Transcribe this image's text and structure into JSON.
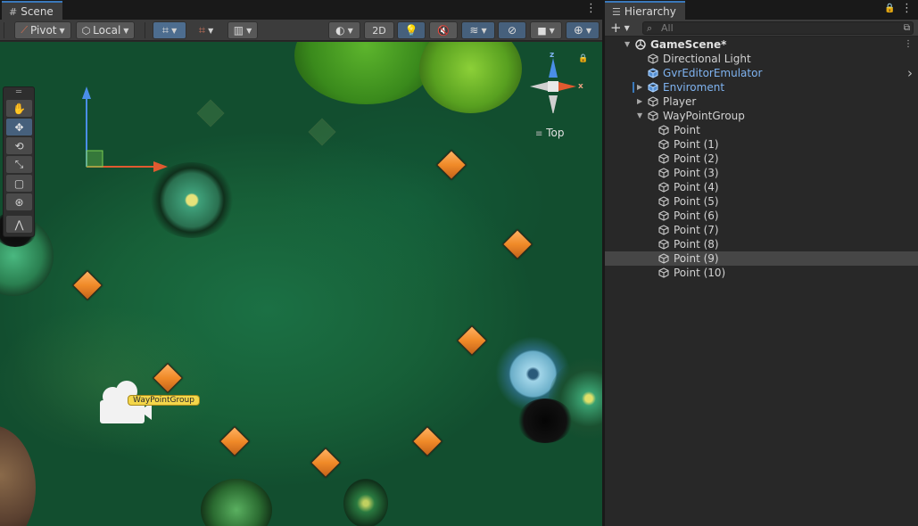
{
  "scene": {
    "tab_label": "Scene",
    "toolbar": {
      "pivot_label": "Pivot",
      "local_label": "Local",
      "mode_2d_label": "2D"
    },
    "gizmo": {
      "view_label": "Top",
      "axis_z": "z",
      "axis_x": "x"
    },
    "waypoint_label": "WayPointGroup",
    "tool_icons": [
      "hand-icon",
      "move-icon",
      "rotate-icon",
      "scale-icon",
      "rect-icon",
      "transform-icon",
      "custom-tool-icon"
    ]
  },
  "hierarchy": {
    "tab_label": "Hierarchy",
    "search_placeholder": "All",
    "items": [
      {
        "label": "GameScene*",
        "depth": 0,
        "type": "scene"
      },
      {
        "label": "Directional Light",
        "depth": 1,
        "type": "object"
      },
      {
        "label": "GvrEditorEmulator",
        "depth": 1,
        "type": "prefab"
      },
      {
        "label": "Enviroment",
        "depth": 1,
        "type": "prefab-collapsed"
      },
      {
        "label": "Player",
        "depth": 1,
        "type": "collapsed"
      },
      {
        "label": "WayPointGroup",
        "depth": 1,
        "type": "expanded"
      },
      {
        "label": "Point",
        "depth": 2,
        "type": "object"
      },
      {
        "label": "Point (1)",
        "depth": 2,
        "type": "object"
      },
      {
        "label": "Point (2)",
        "depth": 2,
        "type": "object"
      },
      {
        "label": "Point (3)",
        "depth": 2,
        "type": "object"
      },
      {
        "label": "Point (4)",
        "depth": 2,
        "type": "object"
      },
      {
        "label": "Point (5)",
        "depth": 2,
        "type": "object"
      },
      {
        "label": "Point (6)",
        "depth": 2,
        "type": "object"
      },
      {
        "label": "Point (7)",
        "depth": 2,
        "type": "object"
      },
      {
        "label": "Point (8)",
        "depth": 2,
        "type": "object"
      },
      {
        "label": "Point (9)",
        "depth": 2,
        "type": "object",
        "highlighted": true
      },
      {
        "label": "Point (10)",
        "depth": 2,
        "type": "object"
      }
    ]
  },
  "colors": {
    "accent": "#3a79bb",
    "prefab_blue": "#7fb3f0",
    "waypoint_orange": "#f08a28"
  }
}
